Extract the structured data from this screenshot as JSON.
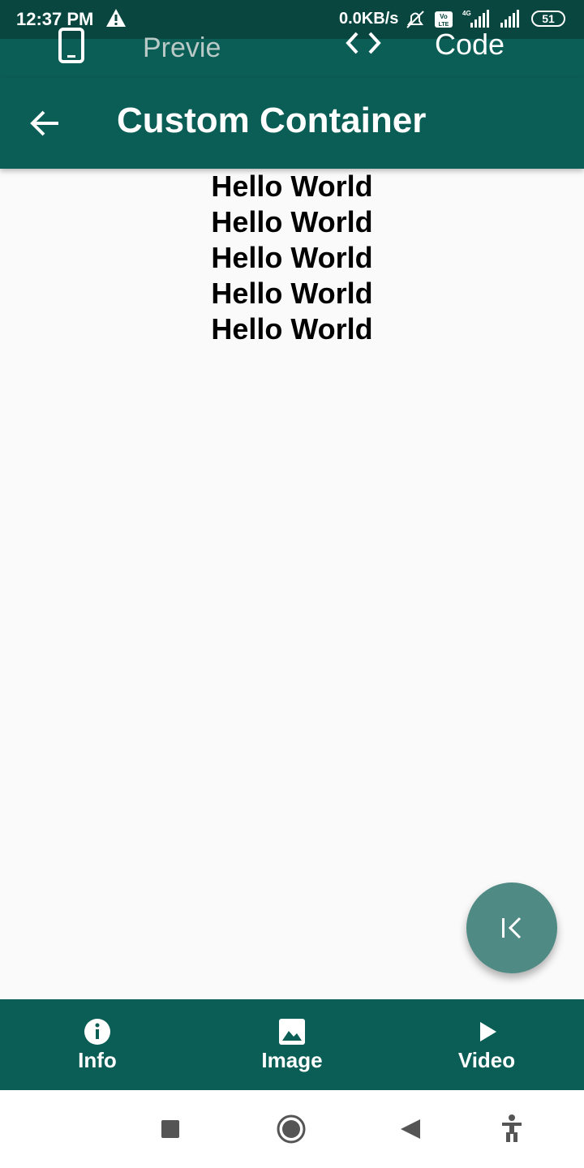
{
  "status_bar": {
    "time": "12:37 PM",
    "network_speed": "0.0KB/s",
    "battery": "51",
    "icons": [
      "warning-icon",
      "mute-bell-icon",
      "volte-icon",
      "signal-4g-icon",
      "signal-icon"
    ]
  },
  "top_tabs": {
    "preview_label": "Preview",
    "code_label": "Code"
  },
  "app_bar": {
    "title": "Custom Container"
  },
  "content": {
    "lines": [
      "Hello World",
      "Hello World",
      "Hello World",
      "Hello World",
      "Hello World"
    ]
  },
  "bottom_nav": {
    "items": [
      {
        "label": "Info",
        "icon": "info-icon"
      },
      {
        "label": "Image",
        "icon": "image-icon"
      },
      {
        "label": "Video",
        "icon": "play-icon"
      }
    ]
  },
  "system_nav": {
    "buttons": [
      "recents-icon",
      "home-icon",
      "back-icon",
      "accessibility-icon"
    ]
  },
  "colors": {
    "primary": "#0b5e56",
    "status_bar": "#08463f",
    "fab": "#4f8a84",
    "background": "#fafafa"
  }
}
